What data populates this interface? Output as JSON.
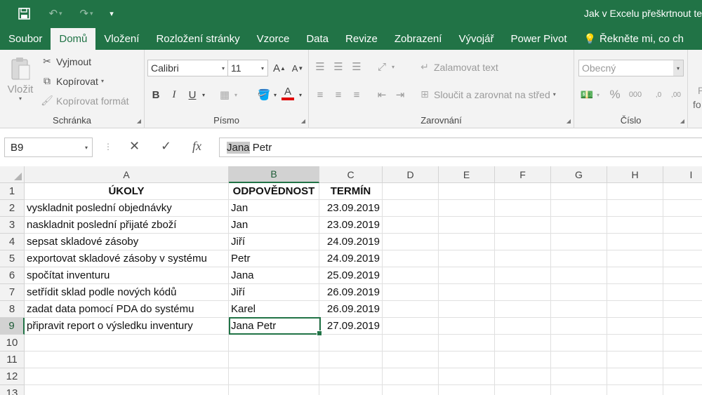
{
  "titlebar": {
    "title": "Jak v Excelu přeškrtnout te",
    "save_icon": "save-icon",
    "undo_icon": "undo-icon",
    "redo_icon": "redo-icon",
    "customize_icon": "customize-qat-icon",
    "brand_color": "#217346"
  },
  "tabs": [
    {
      "label": "Soubor"
    },
    {
      "label": "Domů"
    },
    {
      "label": "Vložení"
    },
    {
      "label": "Rozložení stránky"
    },
    {
      "label": "Vzorce"
    },
    {
      "label": "Data"
    },
    {
      "label": "Revize"
    },
    {
      "label": "Zobrazení"
    },
    {
      "label": "Vývojář"
    },
    {
      "label": "Power Pivot"
    },
    {
      "label": "Řekněte mi, co ch"
    }
  ],
  "ribbon": {
    "clipboard": {
      "label": "Schránka",
      "paste": "Vložit",
      "cut": "Vyjmout",
      "copy": "Kopírovat",
      "format_painter": "Kopírovat formát"
    },
    "font": {
      "label": "Písmo",
      "font_name": "Calibri",
      "font_size": "11",
      "bold": "B",
      "italic": "I",
      "underline": "U",
      "grow": "A",
      "shrink": "A",
      "font_color": "A",
      "font_color_value": "#e00000"
    },
    "alignment": {
      "label": "Zarovnání",
      "wrap_text": "Zalamovat text",
      "merge_center": "Sloučit a zarovnat na střed"
    },
    "number": {
      "label": "Číslo",
      "format": "Obecný",
      "percent": "%",
      "thousands": "000",
      "inc_decimal": ",0",
      "dec_decimal": ",00"
    },
    "styles_partial": {
      "line1": "P",
      "line2": "fo"
    }
  },
  "formula_bar": {
    "name_box": "B9",
    "cancel": "✕",
    "enter": "✓",
    "fx": "fx",
    "value_selected": "Jana",
    "value_rest": " Petr"
  },
  "grid": {
    "columns": [
      "A",
      "B",
      "C",
      "D",
      "E",
      "F",
      "G",
      "H",
      "I"
    ],
    "rows": [
      "1",
      "2",
      "3",
      "4",
      "5",
      "6",
      "7",
      "8",
      "9",
      "10",
      "11",
      "12",
      "13"
    ],
    "headers": {
      "a": "ÚKOLY",
      "b": "ODPOVĚDNOST",
      "c": "TERMÍN"
    },
    "data": [
      {
        "task": "vyskladnit poslední objednávky",
        "owner": "Jan",
        "date": "23.09.2019"
      },
      {
        "task": "naskladnit poslední přijaté zboží",
        "owner": "Jan",
        "date": "23.09.2019"
      },
      {
        "task": "sepsat skladové zásoby",
        "owner": "Jiří",
        "date": "24.09.2019"
      },
      {
        "task": "exportovat skladové zásoby v systému",
        "owner": "Petr",
        "date": "24.09.2019"
      },
      {
        "task": "spočítat inventuru",
        "owner": "Jana",
        "date": "25.09.2019"
      },
      {
        "task": "setřídit sklad podle nových kódů",
        "owner": "Jiří",
        "date": "26.09.2019"
      },
      {
        "task": "zadat data pomocí PDA do systému",
        "owner": "Karel",
        "date": "26.09.2019"
      },
      {
        "task": "připravit report o výsledku inventury",
        "owner": "Jana Petr",
        "date": "27.09.2019"
      }
    ]
  }
}
